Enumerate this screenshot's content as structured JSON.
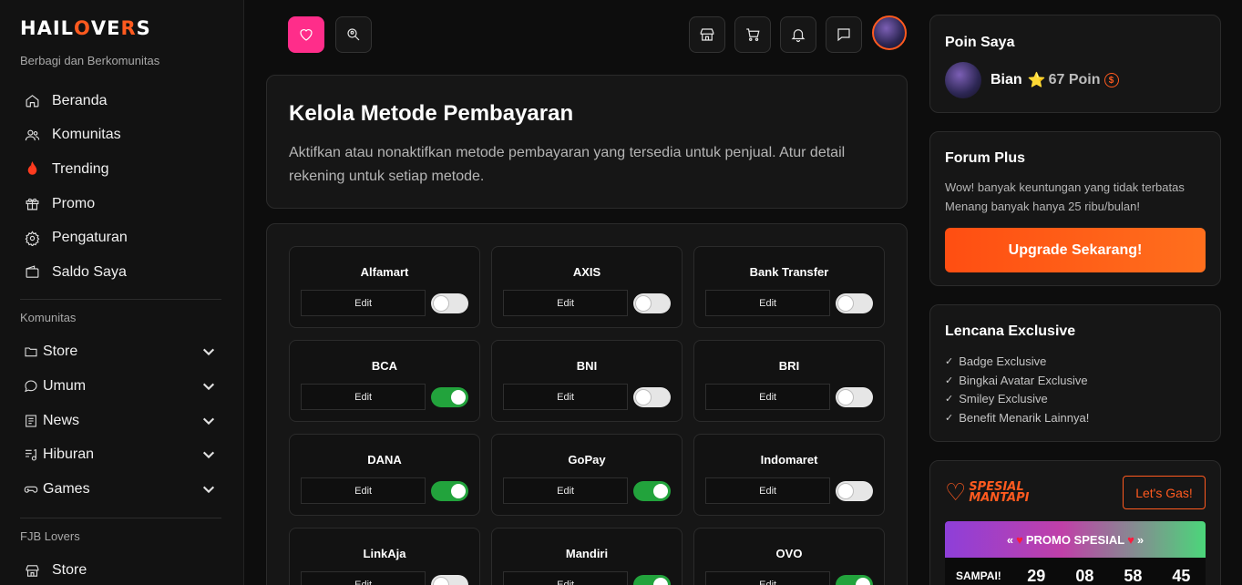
{
  "sidebar": {
    "logo_pre": "HAIL",
    "logo_o": "O",
    "logo_mid": "VE",
    "logo_r": "R",
    "logo_post": "S",
    "tagline": "Berbagi dan Berkomunitas",
    "nav": [
      {
        "label": "Beranda",
        "icon": "home-icon"
      },
      {
        "label": "Komunitas",
        "icon": "users-icon"
      },
      {
        "label": "Trending",
        "icon": "fire-icon"
      },
      {
        "label": "Promo",
        "icon": "gift-icon"
      },
      {
        "label": "Pengaturan",
        "icon": "gear-icon"
      },
      {
        "label": "Saldo Saya",
        "icon": "wallet-icon"
      }
    ],
    "section1_label": "Komunitas",
    "categories": [
      {
        "label": "Store",
        "icon": "folder-icon"
      },
      {
        "label": "Umum",
        "icon": "chat-icon"
      },
      {
        "label": "News",
        "icon": "newspaper-icon"
      },
      {
        "label": "Hiburan",
        "icon": "music-icon"
      },
      {
        "label": "Games",
        "icon": "gamepad-icon"
      }
    ],
    "section2_label": "FJB Lovers",
    "fjb": [
      {
        "label": "Store",
        "icon": "store-icon"
      }
    ]
  },
  "topbar": {
    "icons": [
      "heart-icon",
      "search-location-icon",
      "store-icon",
      "cart-icon",
      "bell-icon",
      "message-icon"
    ]
  },
  "header": {
    "title": "Kelola Metode Pembayaran",
    "description": "Aktifkan atau nonaktifkan metode pembayaran yang tersedia untuk penjual. Atur detail rekening untuk setiap metode."
  },
  "methods": {
    "edit_label": "Edit",
    "items": [
      {
        "name": "Alfamart",
        "enabled": false
      },
      {
        "name": "AXIS",
        "enabled": false
      },
      {
        "name": "Bank Transfer",
        "enabled": false
      },
      {
        "name": "BCA",
        "enabled": true
      },
      {
        "name": "BNI",
        "enabled": false
      },
      {
        "name": "BRI",
        "enabled": false
      },
      {
        "name": "DANA",
        "enabled": true
      },
      {
        "name": "GoPay",
        "enabled": true
      },
      {
        "name": "Indomaret",
        "enabled": false
      },
      {
        "name": "LinkAja",
        "enabled": false
      },
      {
        "name": "Mandiri",
        "enabled": true
      },
      {
        "name": "OVO",
        "enabled": true
      }
    ]
  },
  "poin": {
    "title": "Poin Saya",
    "name": "Bian",
    "star": "⭐",
    "points": "67 Poin",
    "coin": "$"
  },
  "forum_plus": {
    "title": "Forum Plus",
    "line1": "Wow! banyak keuntungan yang tidak terbatas",
    "line2": "Menang banyak hanya 25 ribu/bulan!",
    "button": "Upgrade Sekarang!"
  },
  "lencana": {
    "title": "Lencana Exclusive",
    "items": [
      "Badge Exclusive",
      "Bingkai Avatar Exclusive",
      "Smiley Exclusive",
      "Benefit Menarik Lainnya!"
    ]
  },
  "promo": {
    "logo_line1": "SPESIAL",
    "logo_line2": "MANTAPI",
    "button": "Let's Gas!",
    "banner_left": "«",
    "banner_text": "PROMO SPESIAL",
    "banner_right": "»",
    "countdown_label": "SAMPAI!",
    "countdown": [
      "29",
      "08",
      "58",
      "45"
    ]
  },
  "colors": {
    "accent_orange": "#ff5a1f",
    "accent_pink": "#ff2d8a",
    "toggle_on": "#22a33c"
  }
}
